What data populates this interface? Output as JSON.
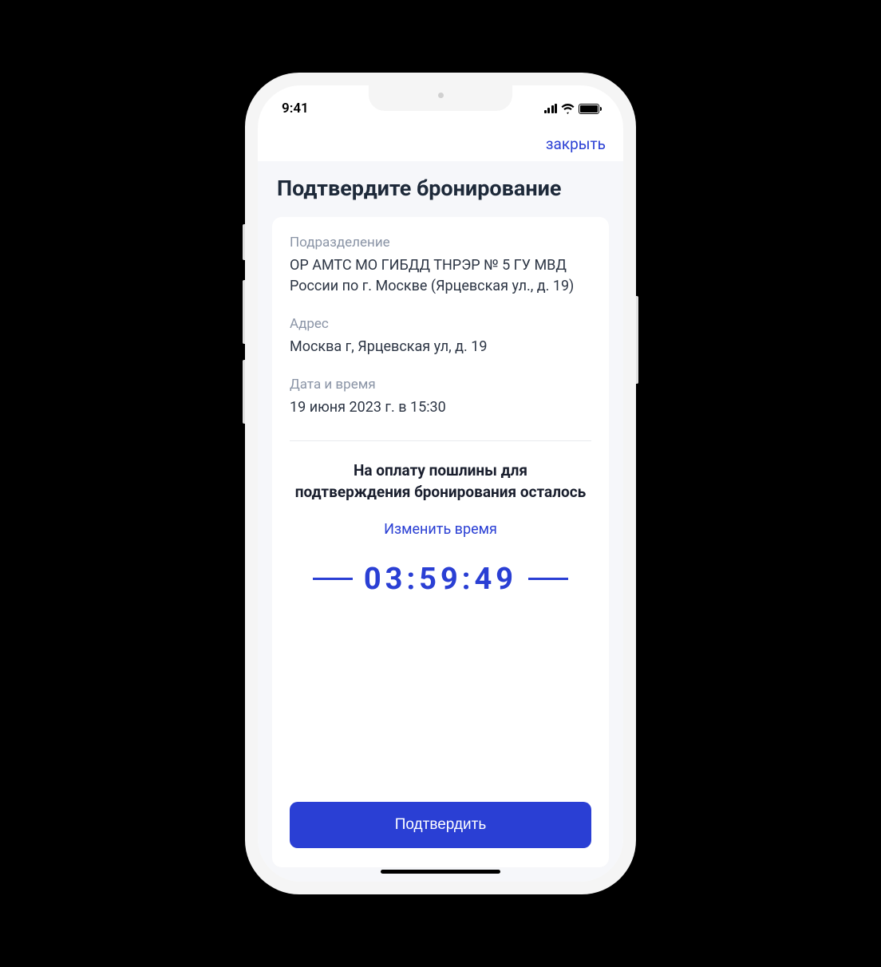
{
  "status": {
    "time": "9:41"
  },
  "nav": {
    "close": "закрыть"
  },
  "title": "Подтвердите бронирование",
  "fields": {
    "department": {
      "label": "Подразделение",
      "value": "ОР АМТС МО ГИБДД ТНРЭР № 5 ГУ МВД России по г. Москве (Ярцевская ул., д. 19)"
    },
    "address": {
      "label": "Адрес",
      "value": "Москва г, Ярцевская ул, д. 19"
    },
    "datetime": {
      "label": "Дата и время",
      "value": "19 июня 2023 г. в 15:30"
    }
  },
  "countdown": {
    "text": "На оплату пошлины для подтверждения бронирования осталось",
    "change_link": "Изменить время",
    "timer": "03:59:49"
  },
  "confirm_button": "Подтвердить"
}
